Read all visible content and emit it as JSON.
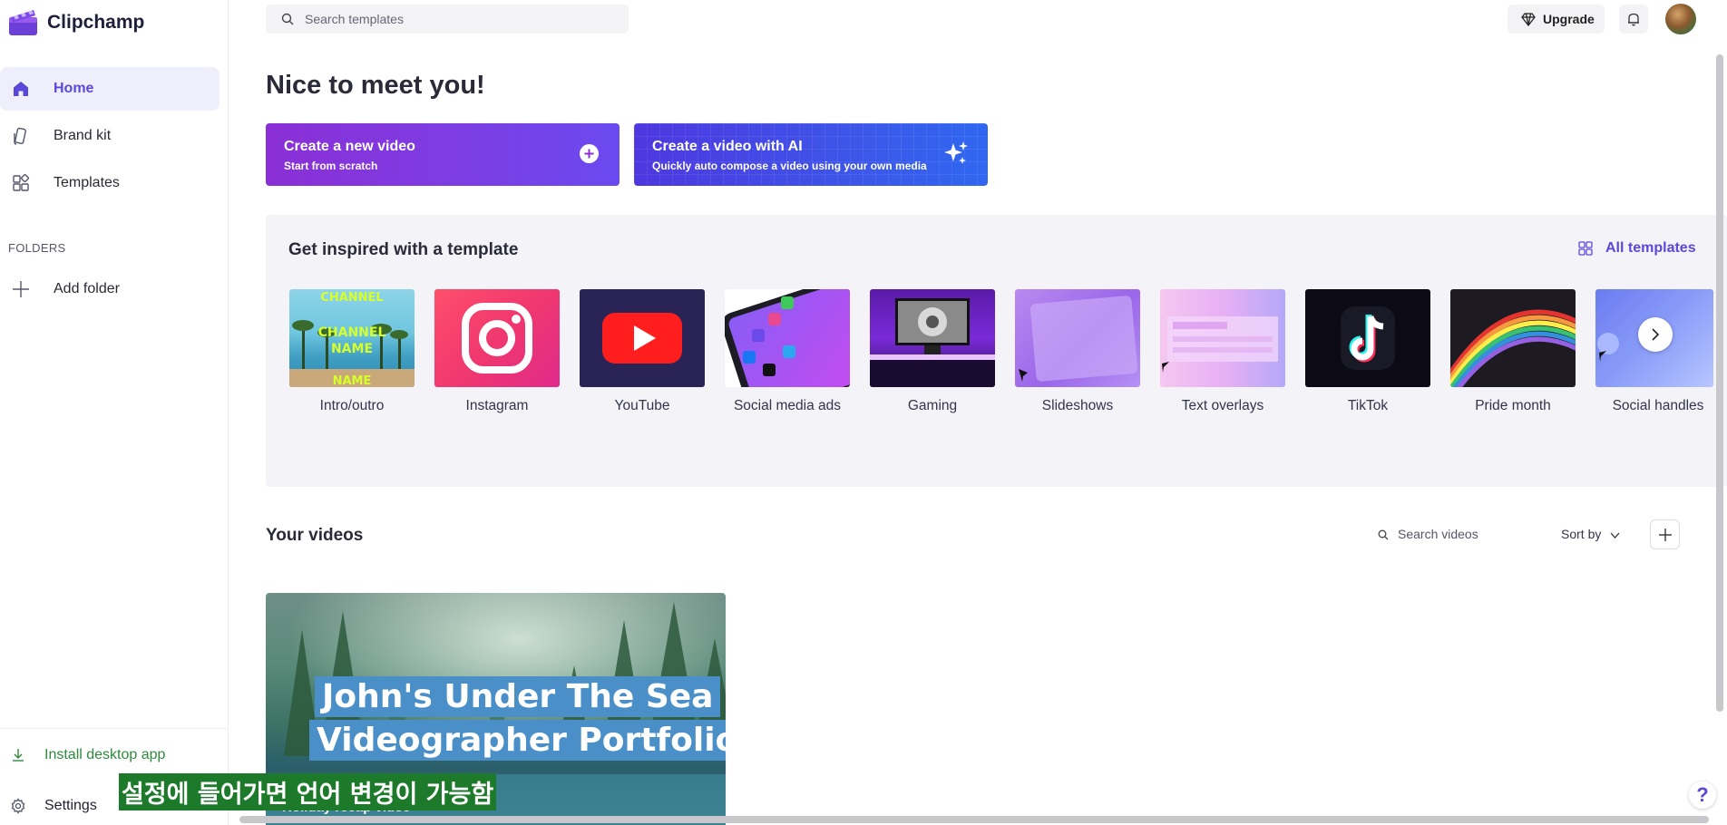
{
  "app": {
    "name": "Clipchamp"
  },
  "sidebar": {
    "items": [
      {
        "label": "Home",
        "icon": "home-icon",
        "active": true
      },
      {
        "label": "Brand kit",
        "icon": "brand-kit-icon",
        "active": false
      },
      {
        "label": "Templates",
        "icon": "templates-icon",
        "active": false
      }
    ],
    "folders_heading": "FOLDERS",
    "add_folder": "Add folder",
    "install": "Install desktop app",
    "settings": "Settings"
  },
  "topbar": {
    "search_placeholder": "Search templates",
    "upgrade": "Upgrade"
  },
  "main": {
    "greeting": "Nice to meet you!",
    "cta_new": {
      "title": "Create a new video",
      "sub": "Start from scratch"
    },
    "cta_ai": {
      "title": "Create a video with AI",
      "sub": "Quickly auto compose a video using your own media"
    },
    "inspire_title": "Get inspired with a template",
    "all_templates": "All templates",
    "templates": [
      {
        "label": "Intro/outro"
      },
      {
        "label": "Instagram"
      },
      {
        "label": "YouTube"
      },
      {
        "label": "Social media ads"
      },
      {
        "label": "Gaming"
      },
      {
        "label": "Slideshows"
      },
      {
        "label": "Text overlays"
      },
      {
        "label": "TikTok"
      },
      {
        "label": "Pride month"
      },
      {
        "label": "Social handles"
      }
    ],
    "intro_thumb_text": [
      "CHANNEL",
      "CHANNEL",
      "NAME",
      "NAME"
    ],
    "videos_title": "Your videos",
    "video_search_placeholder": "Search videos",
    "sort_by": "Sort by",
    "video": {
      "title_line1": "John's Under The Sea",
      "title_line2": "Videographer Portfolio",
      "subtitle": "Holiday recap video"
    }
  },
  "overlay": {
    "caption": "설정에 들어가면 언어 변경이 가능함"
  },
  "colors": {
    "accent": "#5b48d8",
    "cta_purple": "#8a2fd6",
    "cta_blue": "#3d55e8",
    "caption_bg": "#1c7a2a"
  }
}
